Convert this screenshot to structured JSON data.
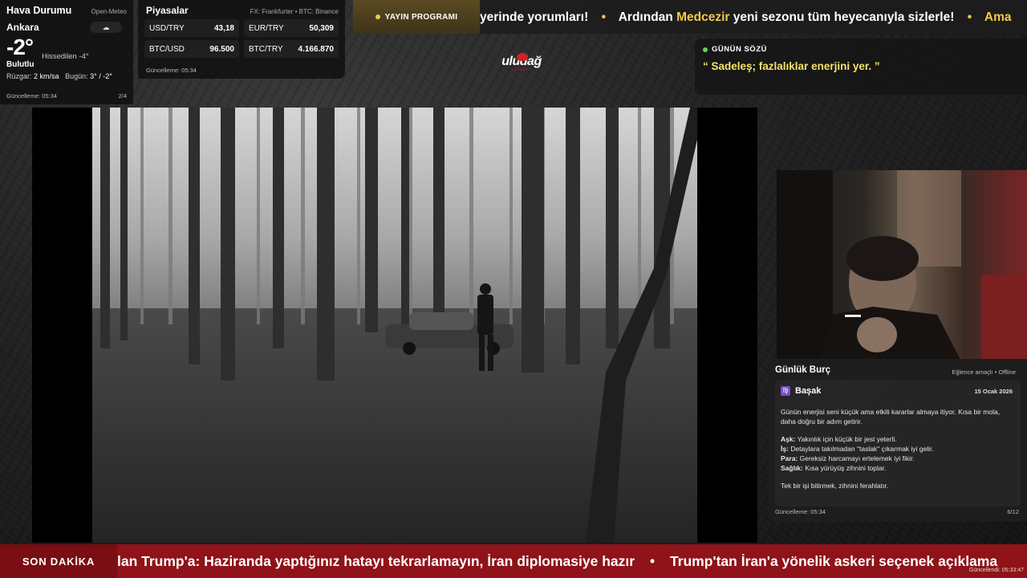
{
  "weather": {
    "title": "Hava Durumu",
    "source": "Open-Meteo",
    "city": "Ankara",
    "icon": "cloud-icon",
    "temperature": "-2°",
    "feels_like": "Hissedilen -4°",
    "description": "Bulutlu",
    "wind_label": "Rüzgar:",
    "wind_value": "2 km/sa",
    "today_label": "Bugün:",
    "today_value": "3° / -2°",
    "updated": "Güncelleme: 05:34",
    "page": "2/4"
  },
  "markets": {
    "title": "Piyasalar",
    "source": "FX: Frankfurter • BTC: Binance",
    "items": [
      {
        "label": "USD/TRY",
        "value": "43,18"
      },
      {
        "label": "EUR/TRY",
        "value": "50,309"
      },
      {
        "label": "BTC/USD",
        "value": "96.500"
      },
      {
        "label": "BTC/TRY",
        "value": "4.166.870"
      }
    ],
    "updated": "Güncelleme: 05:34"
  },
  "schedule": {
    "label": "YAYIN PROGRAMI"
  },
  "top_ticker": {
    "part1": "yerinde yorumları!",
    "part2_pre": "Ardından ",
    "part2_highlight": "Medcezir",
    "part2_post": " yeni sezonu tüm heyecanıyla sizlerle!",
    "part3": "Ama",
    "separator": "•"
  },
  "logo": {
    "text": "uludağ",
    "sub": "SERBEST"
  },
  "quote": {
    "label": "GÜNÜN SÖZÜ",
    "text": "“ Sadeleş; fazlalıklar enerjini yer. ”"
  },
  "horoscope": {
    "title": "Günlük Burç",
    "meta": "Eğlence amaçlı • Offline",
    "sign_icon": "virgo-icon",
    "sign_glyph": "♍",
    "sign": "Başak",
    "date": "15 Ocak 2026",
    "intro": "Günün enerjisi seni küçük ama etkili kararlar almaya itiyor. Kısa bir mola, daha doğru bir adım getirir.",
    "love_label": "Aşk:",
    "love": " Yakınlık için küçük bir jest yeterli.",
    "work_label": "İş:",
    "work": " Detaylara takılmadan \"taslak\" çıkarmak iyi gelir.",
    "money_label": "Para:",
    "money": " Gereksiz harcamayı ertelemek iyi fikir.",
    "health_label": "Sağlık:",
    "health": " Kısa yürüyüş zihnini toplar.",
    "advice": "Tek bir işi bitirmek, zihnini ferahlatır.",
    "updated": "Güncelleme: 05:34",
    "page": "6/12"
  },
  "breaking": {
    "label": "SON DAKİKA",
    "item1": "lan Trump'a: Haziranda yaptığınız hatayı tekrarlamayın, İran diplomasiye hazır",
    "separator": "•",
    "item2": "Trump'tan İran'a yönelik askeri seçenek açıklama",
    "updated": "Güncellendi: 05:33:47"
  },
  "colors": {
    "accent_yellow": "#f3c84b",
    "breaking_red": "#8f1318",
    "quote_yellow": "#f3e36a",
    "status_green": "#5fd45f"
  }
}
